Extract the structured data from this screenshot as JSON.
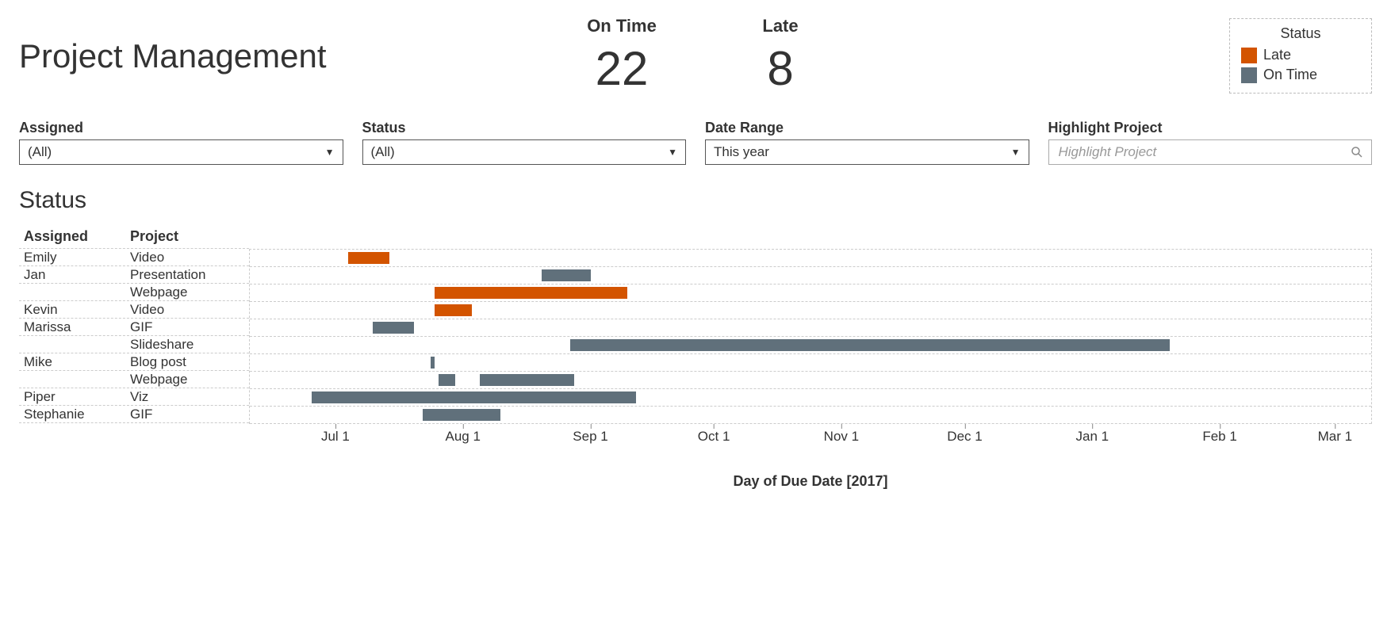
{
  "title": "Project Management",
  "kpis": [
    {
      "label": "On Time",
      "value": "22"
    },
    {
      "label": "Late",
      "value": "8"
    }
  ],
  "legend": {
    "title": "Status",
    "items": [
      {
        "label": "Late",
        "color": "#d35400"
      },
      {
        "label": "On Time",
        "color": "#60707b"
      }
    ]
  },
  "filters": {
    "assigned": {
      "label": "Assigned",
      "value": "(All)"
    },
    "status": {
      "label": "Status",
      "value": "(All)"
    },
    "dateRange": {
      "label": "Date Range",
      "value": "This year"
    },
    "highlight": {
      "label": "Highlight Project",
      "placeholder": "Highlight Project"
    }
  },
  "chart": {
    "section_title": "Status",
    "table_headers": {
      "assigned": "Assigned",
      "project": "Project"
    },
    "axis_label": "Day of Due Date [2017]"
  },
  "colors": {
    "late": "#d35400",
    "ontime": "#60707b"
  },
  "chart_data": {
    "type": "bar",
    "orientation": "gantt",
    "x_axis": {
      "domain_start": "2017-06-10",
      "domain_end": "2018-03-10",
      "ticks": [
        "Jul 1",
        "Aug 1",
        "Sep 1",
        "Oct 1",
        "Nov 1",
        "Dec 1",
        "Jan 1",
        "Feb 1",
        "Mar 1"
      ]
    },
    "rows": [
      {
        "assigned": "Emily",
        "project": "Video",
        "start": "2017-07-04",
        "end": "2017-07-14",
        "status": "Late"
      },
      {
        "assigned": "Jan",
        "project": "Presentation",
        "start": "2017-08-20",
        "end": "2017-09-01",
        "status": "On Time"
      },
      {
        "assigned": "Jan",
        "project": "Webpage",
        "start": "2017-07-25",
        "end": "2017-09-10",
        "status": "Late"
      },
      {
        "assigned": "Kevin",
        "project": "Video",
        "start": "2017-07-25",
        "end": "2017-08-03",
        "status": "Late"
      },
      {
        "assigned": "Marissa",
        "project": "GIF",
        "start": "2017-07-10",
        "end": "2017-07-20",
        "status": "On Time"
      },
      {
        "assigned": "Marissa",
        "project": "Slideshare",
        "start": "2017-08-27",
        "end": "2018-01-20",
        "status": "On Time"
      },
      {
        "assigned": "Mike",
        "project": "Blog post",
        "start": "2017-07-24",
        "end": "2017-07-25",
        "status": "On Time"
      },
      {
        "assigned": "Mike",
        "project": "Webpage",
        "start": "2017-07-26",
        "end": "2017-07-30",
        "status": "On Time",
        "extra": {
          "start": "2017-08-05",
          "end": "2017-08-28",
          "status": "On Time"
        }
      },
      {
        "assigned": "Piper",
        "project": "Viz",
        "start": "2017-06-25",
        "end": "2017-09-12",
        "status": "On Time"
      },
      {
        "assigned": "Stephanie",
        "project": "GIF",
        "start": "2017-07-22",
        "end": "2017-08-10",
        "status": "On Time"
      }
    ]
  }
}
